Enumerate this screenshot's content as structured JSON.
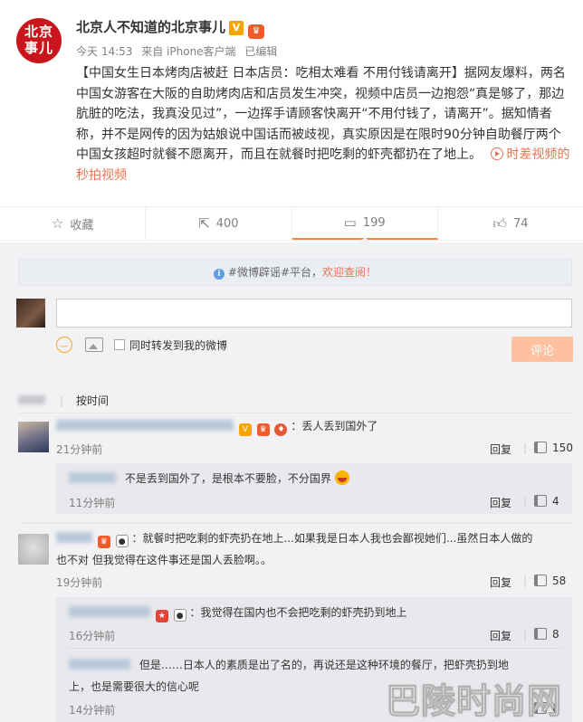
{
  "post": {
    "avatar_text_line1": "北京",
    "avatar_text_line2": "事儿",
    "author": "北京人不知道的北京事儿",
    "verified_badge": "V",
    "time": "今天 14:53",
    "source": "来自 iPhone客户端",
    "edited": "已编辑",
    "text": "【中国女生日本烤肉店被赶 日本店员：吃相太难看 不用付钱请离开】据网友爆料，两名中国女游客在大阪的自助烤肉店和店员发生冲突，视频中店员一边抱怨“真是够了，那边肮脏的吃法，我真没见过”，一边挥手请顾客快离开“不用付钱了，请离开”。据知情者称，并不是网传的因为姑娘说中国话而被歧视，真实原因是在限时90分钟自助餐厅两个中国女孩超时就餐不愿离开，而且在就餐时把吃剩的虾壳都扔在了地上。",
    "video_link": "时差视频的秒拍视频"
  },
  "actions": {
    "favorite": "收藏",
    "forward": "400",
    "comment": "199",
    "like": "74"
  },
  "notice": {
    "prefix": "#微博辟谣#平台，",
    "link": "欢迎查阅！"
  },
  "composer": {
    "forward_label": "同时转发到我的微博",
    "submit_label": "评论"
  },
  "sort": {
    "label": "按时间"
  },
  "comments": [
    {
      "text": "：丢人丢到国外了",
      "time": "21分钟前",
      "reply": "回复",
      "likes": "150",
      "sub": {
        "text": "不是丢到国外了，是根本不要脸，不分国界",
        "time": "11分钟前",
        "reply": "回复",
        "likes": "4"
      }
    },
    {
      "text_line1": "：就餐时把吃剩的虾壳扔在地上...如果我是日本人我也会鄙视她们...虽然日本人做的",
      "text_line2": "也不对 但我觉得在这件事还是国人丢脸啊。。",
      "time": "19分钟前",
      "reply": "回复",
      "likes": "58",
      "subs": [
        {
          "text": "：我觉得在国内也不会把吃剩的虾壳扔到地上",
          "time": "16分钟前",
          "reply": "回复",
          "likes": "8"
        },
        {
          "text_line1": "但是……日本人的素质是出了名的，再说还是这种环境的餐厅，把虾壳扔到地",
          "text_line2": "上，也是需要很大的信心呢",
          "time": "14分钟前",
          "likes": "6"
        }
      ]
    }
  ],
  "watermark": "巴陵时尚网",
  "colors": {
    "accent": "#eb7350",
    "brand_red": "#c9161d",
    "panel_bg": "#f2f2f5"
  }
}
